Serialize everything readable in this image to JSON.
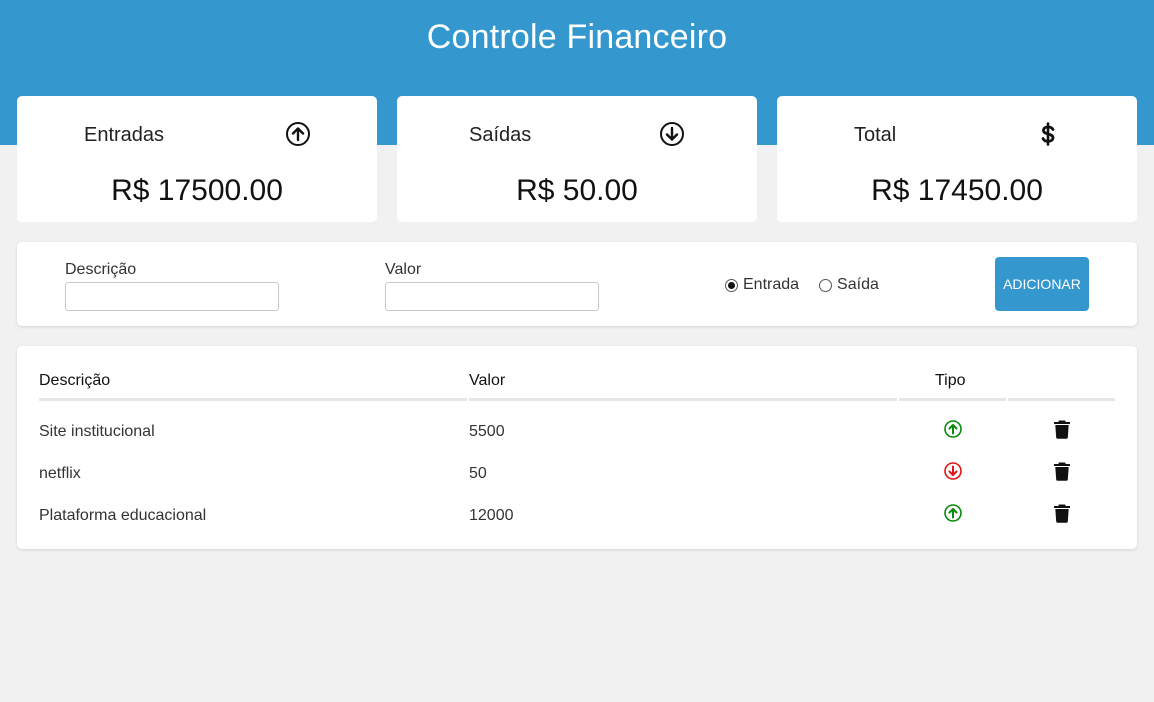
{
  "header": {
    "title": "Controle Financeiro"
  },
  "summary": {
    "entradas": {
      "label": "Entradas",
      "value": "R$ 17500.00",
      "icon": "arrow-up-circle-icon"
    },
    "saidas": {
      "label": "Saídas",
      "value": "R$ 50.00",
      "icon": "arrow-down-circle-icon"
    },
    "total": {
      "label": "Total",
      "value": "R$ 17450.00",
      "icon": "dollar-icon"
    }
  },
  "form": {
    "descricao_label": "Descrição",
    "descricao_value": "",
    "valor_label": "Valor",
    "valor_value": "",
    "radio_entrada": "Entrada",
    "radio_saida": "Saída",
    "selected": "Entrada",
    "add_button": "ADICIONAR"
  },
  "table": {
    "headers": {
      "descricao": "Descrição",
      "valor": "Valor",
      "tipo": "Tipo"
    },
    "rows": [
      {
        "descricao": "Site institucional",
        "valor": "5500",
        "tipo": "entrada"
      },
      {
        "descricao": "netflix",
        "valor": "50",
        "tipo": "saida"
      },
      {
        "descricao": "Plataforma educacional",
        "valor": "12000",
        "tipo": "entrada"
      }
    ]
  },
  "colors": {
    "primary": "#3498cf",
    "income": "#0a8a0a",
    "expense": "#e01515",
    "background": "#f1f1f1"
  }
}
